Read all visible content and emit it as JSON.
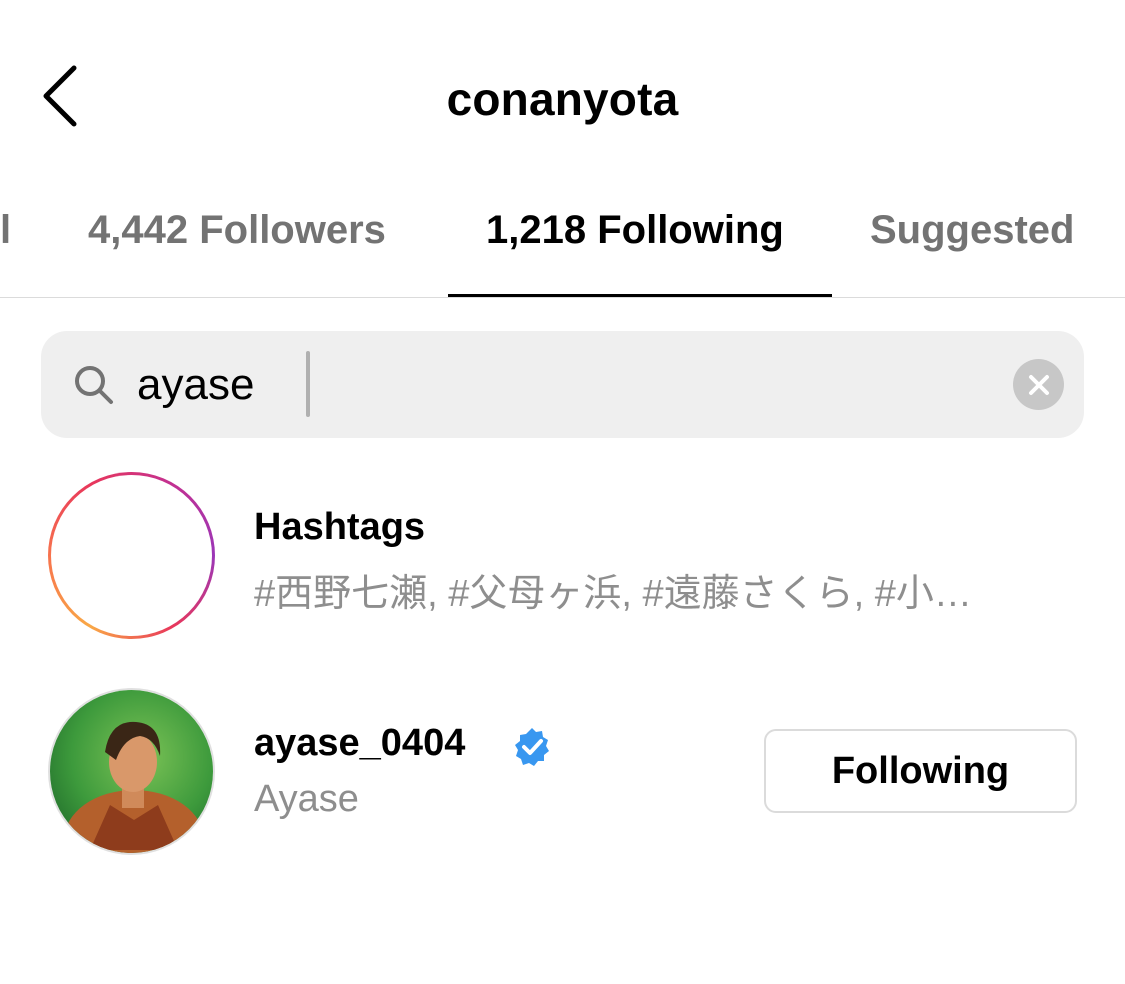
{
  "header": {
    "title": "conanyota"
  },
  "tabs": [
    {
      "label": "l"
    },
    {
      "label": "4,442 Followers"
    },
    {
      "label": "1,218 Following",
      "active": true
    },
    {
      "label": "Suggested"
    }
  ],
  "search": {
    "value": "ayase"
  },
  "results": [
    {
      "title": "Hashtags",
      "subtitle": "#西野七瀬, #父母ヶ浜, #遠藤さくら, #小…"
    },
    {
      "title": "ayase_0404",
      "subtitle": "Ayase",
      "verified": true,
      "button_label": "Following"
    }
  ],
  "colors": {
    "verified": "#3897f0",
    "muted": "#8e8e8e",
    "tab_inactive": "#737373"
  }
}
